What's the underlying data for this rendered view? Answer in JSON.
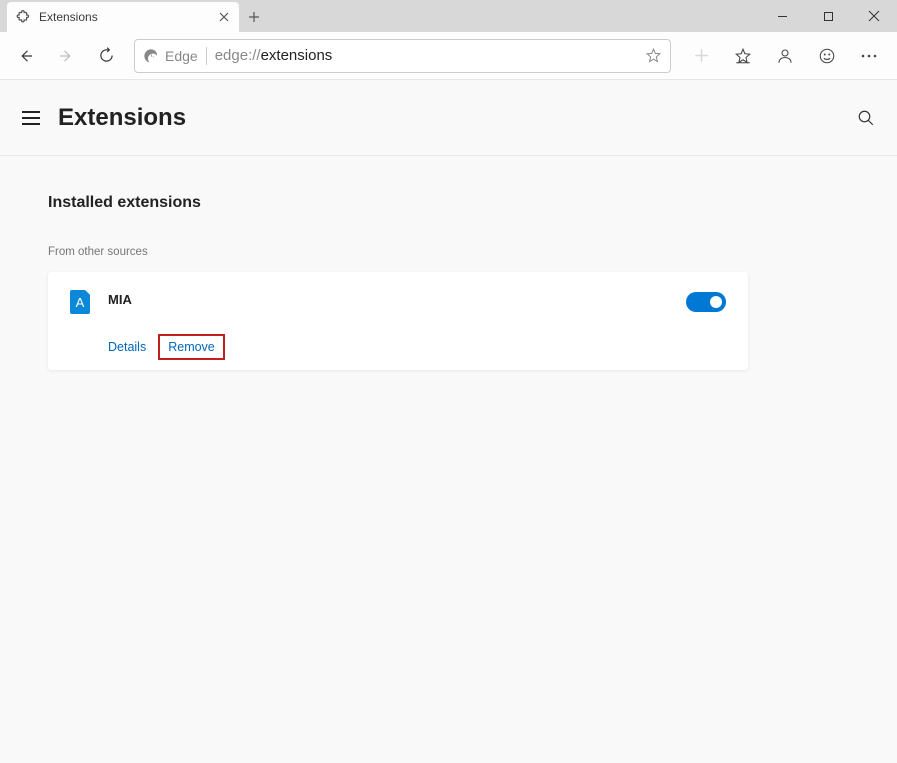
{
  "window": {
    "tab_title": "Extensions"
  },
  "addressbar": {
    "identity": "Edge",
    "url_scheme": "edge://",
    "url_path": "extensions"
  },
  "page": {
    "title": "Extensions",
    "section_title": "Installed extensions",
    "source_label": "From other sources"
  },
  "extension": {
    "name": "MIA",
    "icon_letter": "A",
    "details_label": "Details",
    "remove_label": "Remove",
    "enabled": true
  }
}
